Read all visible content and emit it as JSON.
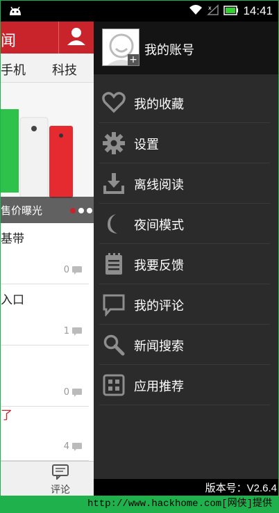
{
  "status_bar": {
    "time": "14:41",
    "icons": [
      "android-icon",
      "wifi-icon",
      "no-signal-icon",
      "battery-icon"
    ],
    "battery_color": "#30d030"
  },
  "app": {
    "logo_fragment": "闻",
    "categories": [
      "手机",
      "科技"
    ],
    "banner_caption": "售价曝光",
    "news": [
      {
        "title": "基带",
        "count": "0",
        "red": false
      },
      {
        "title": "入口",
        "count": "1",
        "red": false
      },
      {
        "title": "",
        "count": "0",
        "red": false
      },
      {
        "title": "了",
        "count": "4",
        "red": true
      }
    ],
    "bottom_comment_label": "评论",
    "accent_color": "#c9242b"
  },
  "drawer": {
    "account_label": "我的账号",
    "menu": [
      {
        "label": "我的收藏",
        "icon": "heart-icon"
      },
      {
        "label": "设置",
        "icon": "gear-icon"
      },
      {
        "label": "离线阅读",
        "icon": "download-tray-icon"
      },
      {
        "label": "夜间模式",
        "icon": "moon-icon"
      },
      {
        "label": "我要反馈",
        "icon": "notepad-icon"
      },
      {
        "label": "我的评论",
        "icon": "speech-bubble-icon"
      },
      {
        "label": "新闻搜索",
        "icon": "search-icon"
      },
      {
        "label": "应用推荐",
        "icon": "apps-grid-icon"
      }
    ],
    "version": "版本号：V2.6.4"
  },
  "watermark": "http://www.hackhome.com[网侠]提供"
}
